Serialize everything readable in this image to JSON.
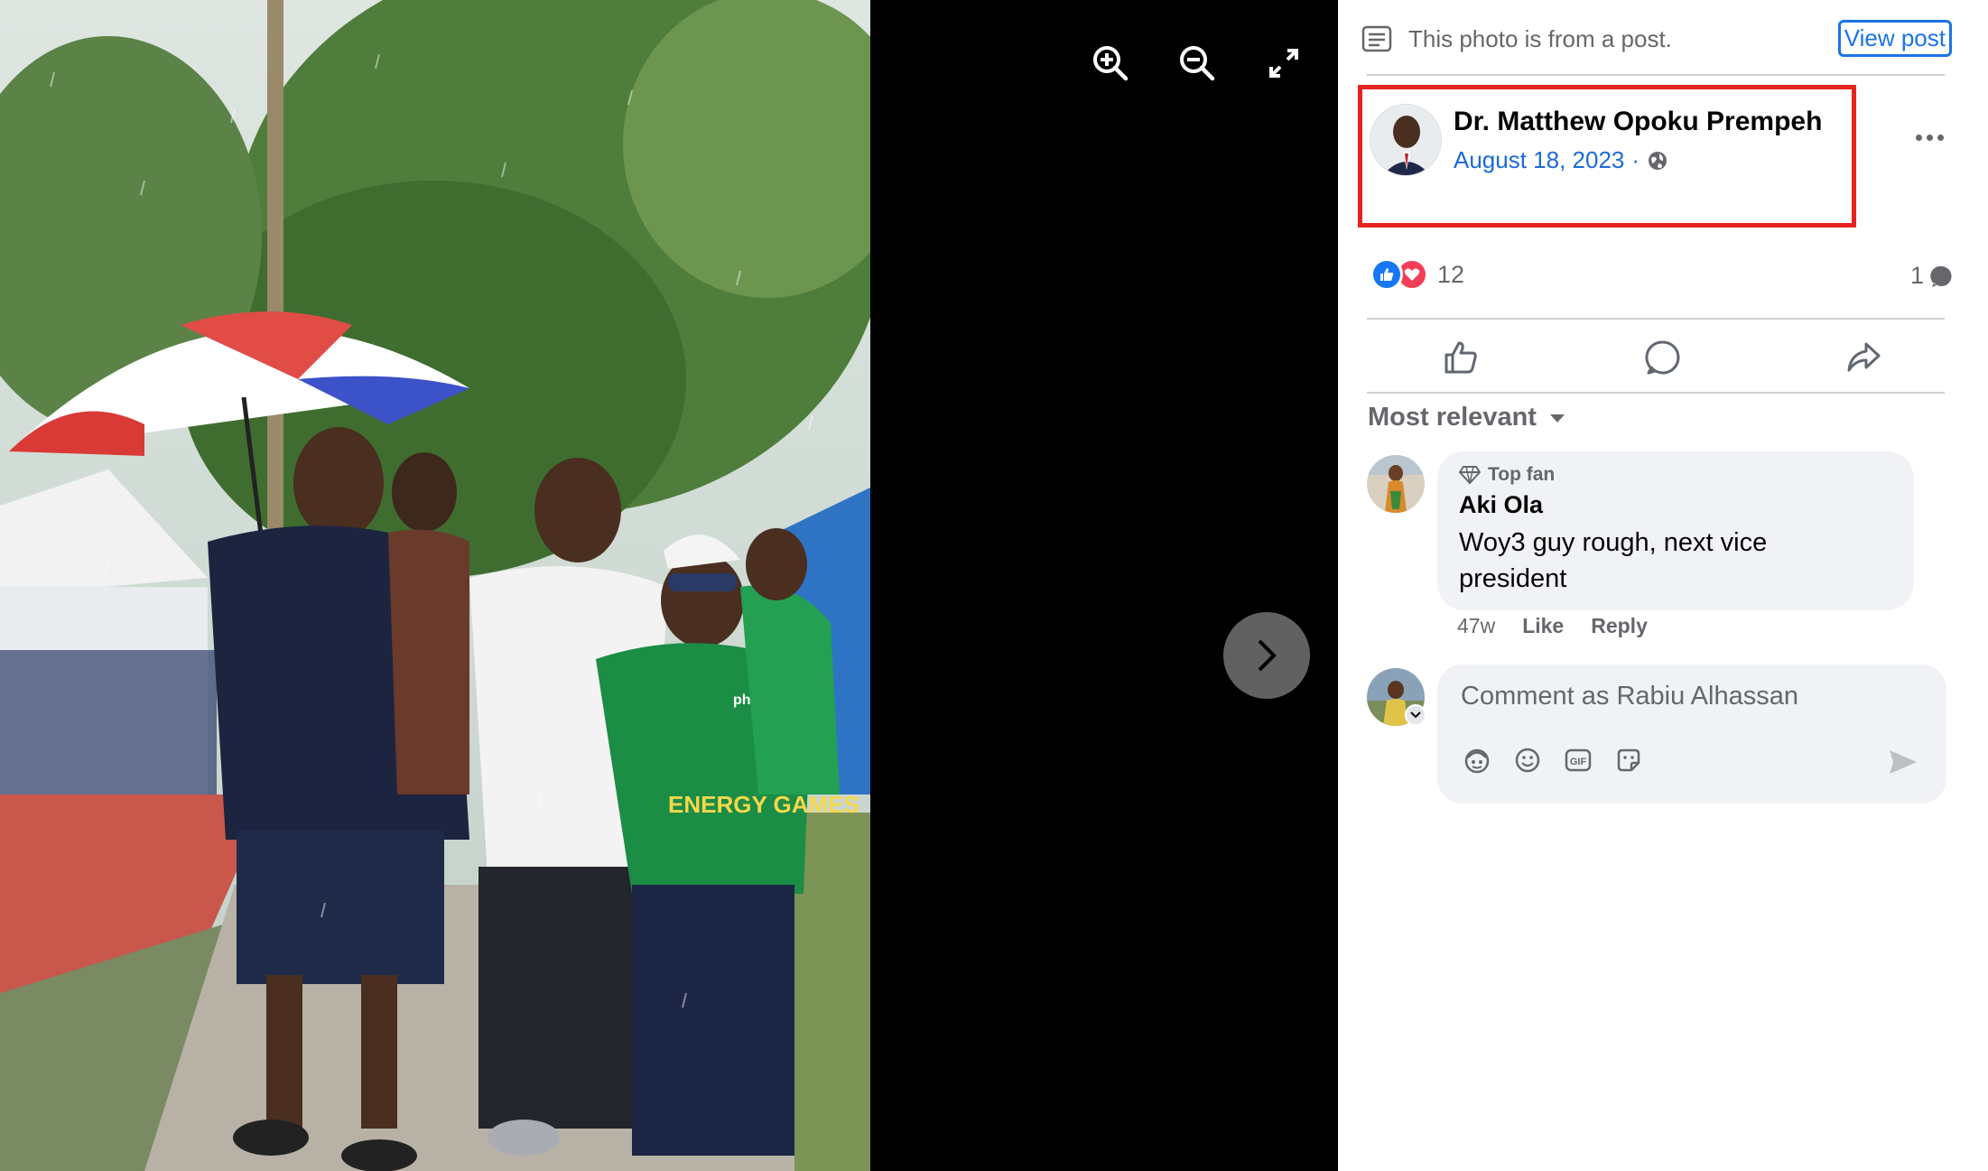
{
  "viewer": {
    "controls": [
      "zoom-in-icon",
      "zoom-out-icon",
      "fullscreen-icon"
    ],
    "next_icon": "chevron-right-icon",
    "photo_shirt_text": "ENERGY GAMES",
    "photo_logo_text": "phdc"
  },
  "panel": {
    "post_notice": "This photo is from a post.",
    "view_post_label": "View post",
    "author": {
      "name": "Dr. Matthew Opoku Prempeh",
      "date": "August 18, 2023",
      "separator": "·",
      "audience_icon": "globe-icon"
    },
    "reactions": {
      "count": "12",
      "types": [
        "like",
        "love"
      ]
    },
    "comment_count": "1",
    "actions": [
      "like-icon",
      "comment-icon",
      "share-icon"
    ],
    "sort": {
      "label": "Most relevant"
    },
    "comment": {
      "badge": "Top fan",
      "author": "Aki Ola",
      "text": "Woy3 guy rough, next vice president",
      "age": "47w",
      "like_label": "Like",
      "reply_label": "Reply"
    },
    "composer": {
      "placeholder": "Comment as Rabiu Alhassan",
      "tools": [
        "avatar-sticker-icon",
        "emoji-icon",
        "gif-icon",
        "sticker-icon"
      ]
    }
  },
  "colors": {
    "highlight": "#e52420",
    "link": "#1b74e4",
    "like": "#1877f2",
    "love": "#f33e58"
  }
}
